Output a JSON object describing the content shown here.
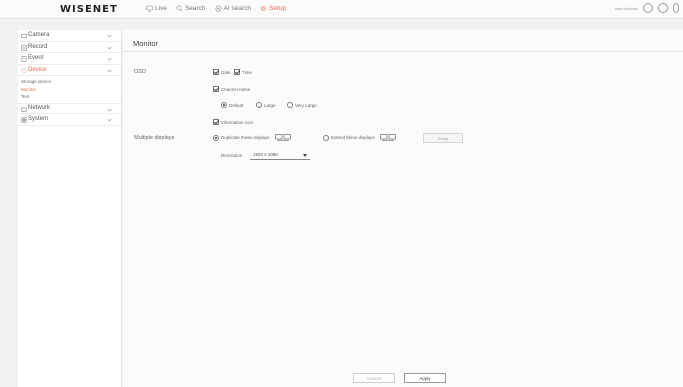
{
  "header": {
    "logo": "WISENET",
    "nav": [
      {
        "label": "Live",
        "icon": "monitor-icon"
      },
      {
        "label": "Search",
        "icon": "search-icon"
      },
      {
        "label": "AI search",
        "icon": "ai-search-icon"
      },
      {
        "label": "Setup",
        "icon": "gear-icon",
        "active": true
      }
    ],
    "user_text": "nhbs.nilobaw"
  },
  "sidebar": {
    "items": [
      {
        "label": "Camera",
        "icon": "camera-icon"
      },
      {
        "label": "Record",
        "icon": "record-icon"
      },
      {
        "label": "Event",
        "icon": "event-icon"
      },
      {
        "label": "Device",
        "icon": "device-icon",
        "active": true
      },
      {
        "label": "Network",
        "icon": "network-icon"
      },
      {
        "label": "System",
        "icon": "system-icon"
      }
    ],
    "device_sub": [
      {
        "label": "Storage device"
      },
      {
        "label": "Monitor",
        "active": true
      },
      {
        "label": "Text"
      }
    ]
  },
  "main": {
    "title": "Monitor",
    "osd_label": "OSD",
    "osd_date": "Date",
    "osd_time": "Time",
    "channel_name": "Channel name",
    "size_default": "Default",
    "size_large": "Large",
    "size_very_large": "Very Large",
    "information_icon": "Information icon",
    "multiple_displays_label": "Multiple displays",
    "duplicate_displays": "Duplicate these displays",
    "extend_displays": "Extend these displays",
    "setup_button": "Setup",
    "resolution_label": "Resolution",
    "resolution_value": "1920 x 1080"
  },
  "footer": {
    "cancel": "Cancel",
    "apply": "Apply"
  },
  "colors": {
    "accent": "#e8674a"
  }
}
